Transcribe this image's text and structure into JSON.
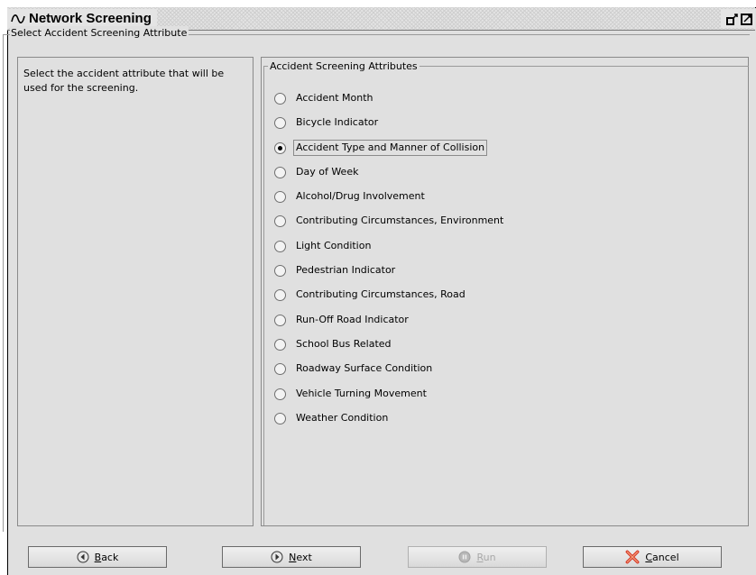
{
  "window": {
    "title": "Network Screening",
    "title_icon": "wave-icon",
    "controls": [
      "undock-icon",
      "maximize-icon"
    ]
  },
  "outer_group": {
    "legend": "Select Accident Screening Attribute"
  },
  "instructions": {
    "text": "Select the accident attribute that will be used for the screening."
  },
  "attributes_group": {
    "legend": "Accident Screening Attributes",
    "selected": "Accident Type and Manner of Collision",
    "options": [
      {
        "label": "Accident Month",
        "checked": false
      },
      {
        "label": "Bicycle Indicator",
        "checked": false
      },
      {
        "label": "Accident Type and Manner of Collision",
        "checked": true
      },
      {
        "label": "Day of Week",
        "checked": false
      },
      {
        "label": "Alcohol/Drug Involvement",
        "checked": false
      },
      {
        "label": "Contributing Circumstances, Environment",
        "checked": false
      },
      {
        "label": "Light Condition",
        "checked": false
      },
      {
        "label": "Pedestrian Indicator",
        "checked": false
      },
      {
        "label": "Contributing Circumstances, Road",
        "checked": false
      },
      {
        "label": "Run-Off Road Indicator",
        "checked": false
      },
      {
        "label": "School Bus Related",
        "checked": false
      },
      {
        "label": "Roadway Surface Condition",
        "checked": false
      },
      {
        "label": "Vehicle Turning Movement",
        "checked": false
      },
      {
        "label": "Weather Condition",
        "checked": false
      }
    ]
  },
  "buttons": {
    "back": {
      "first": "B",
      "rest": "ack",
      "icon": "back-arrow-icon",
      "enabled": true
    },
    "next": {
      "first": "N",
      "rest": "ext",
      "icon": "next-arrow-icon",
      "enabled": true
    },
    "run": {
      "first": "R",
      "rest": "un",
      "icon": "run-icon",
      "enabled": false
    },
    "cancel": {
      "first": "C",
      "rest": "ancel",
      "icon": "cancel-x-icon",
      "enabled": true
    }
  },
  "colors": {
    "window_bg": "#e0e0e0",
    "cancel_icon": "#d63a2a",
    "disabled_text": "#a8a8a8"
  }
}
